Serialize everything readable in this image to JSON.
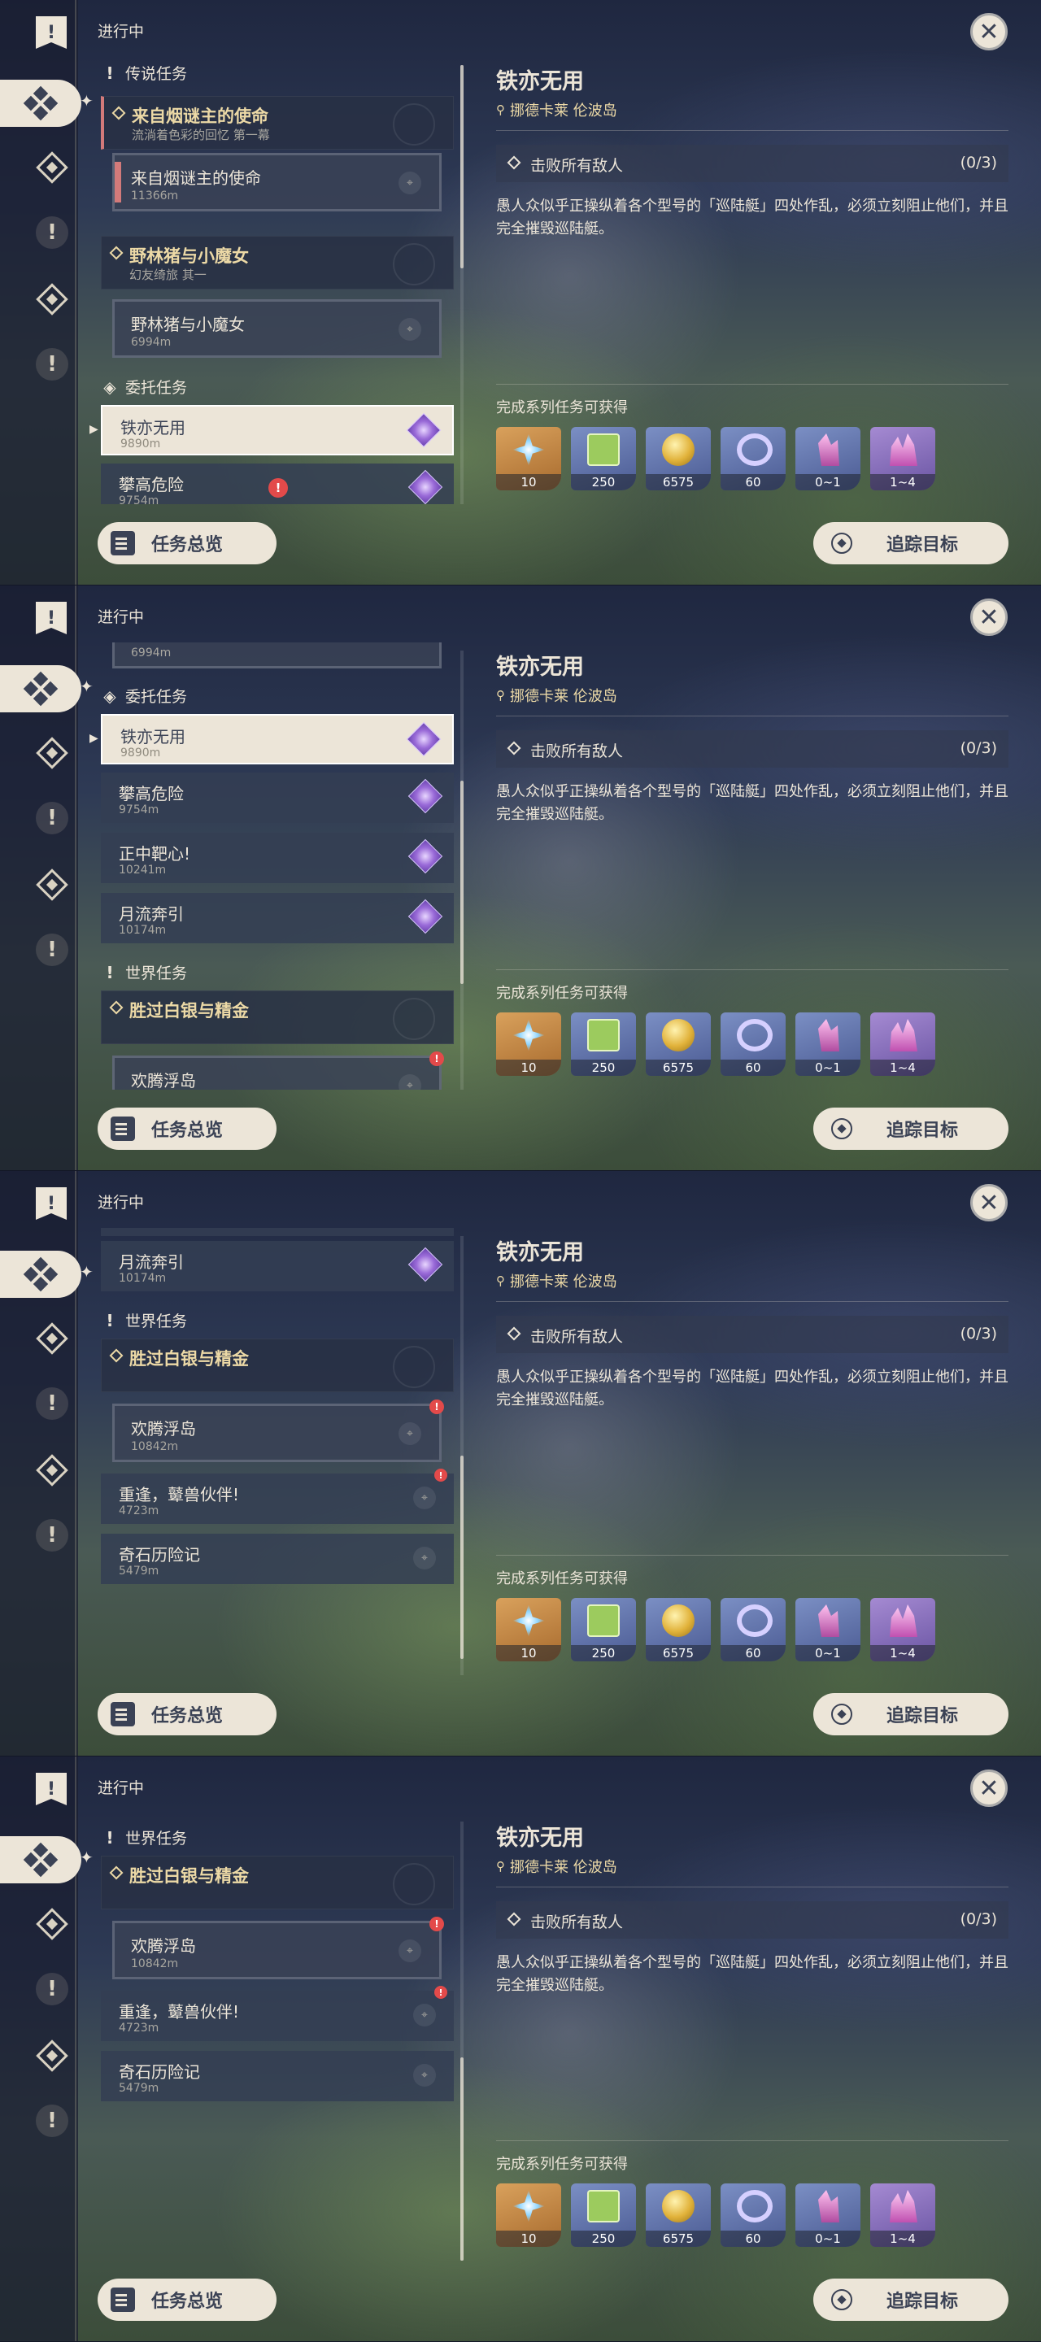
{
  "header": {
    "status_label": "进行中"
  },
  "sections": {
    "legend": "传说任务",
    "commission": "委托任务",
    "world": "世界任务"
  },
  "quests": {
    "legend1": {
      "name": "来自烟谜主的使命",
      "subtitle": "流淌着色彩的回忆  第一幕"
    },
    "legend1_step": {
      "name": "来自烟谜主的使命",
      "distance": "11366m"
    },
    "legend2": {
      "name": "野林猪与小魔女",
      "subtitle": "幻友绮旅 其一"
    },
    "legend2_step": {
      "name": "野林猪与小魔女",
      "distance": "6994m"
    },
    "c1": {
      "name": "铁亦无用",
      "distance": "9890m"
    },
    "c2": {
      "name": "攀高危险",
      "distance": "9754m"
    },
    "c3": {
      "name": "正中靶心!",
      "distance": "10241m"
    },
    "c4": {
      "name": "月流奔引",
      "distance": "10174m"
    },
    "world1": {
      "name": "胜过白银与精金"
    },
    "world1_step": {
      "name": "欢腾浮岛",
      "distance": "10842m"
    },
    "w2": {
      "name": "重逢，鼙兽伙伴!",
      "distance": "4723m"
    },
    "w3": {
      "name": "奇石历险记",
      "distance": "5479m"
    }
  },
  "detail": {
    "title": "铁亦无用",
    "location": "挪德卡莱 伦波岛",
    "objective": "击败所有敌人",
    "progress": "(0/3)",
    "description": "愚人众似乎正操纵着各个型号的「巡陆艇」四处作乱，必须立刻阻止他们，并且完全摧毁巡陆艇。",
    "rewards_label": "完成系列任务可获得",
    "rewards": [
      {
        "icon": "primogem-icon",
        "count": "10"
      },
      {
        "icon": "adventure-exp-icon",
        "count": "250"
      },
      {
        "icon": "mora-icon",
        "count": "6575"
      },
      {
        "icon": "ore-icon",
        "count": "60"
      },
      {
        "icon": "crystal-icon",
        "count": "0~1"
      },
      {
        "icon": "crystal-cluster-icon",
        "count": "1~4"
      }
    ]
  },
  "buttons": {
    "overview": "任务总览",
    "track": "追踪目标"
  },
  "colors": {
    "accent": "#ece5d8",
    "legend_gold": "#ecd9a6",
    "alert_red": "#e34a4a",
    "commission_purple": "#9a6bd8"
  }
}
